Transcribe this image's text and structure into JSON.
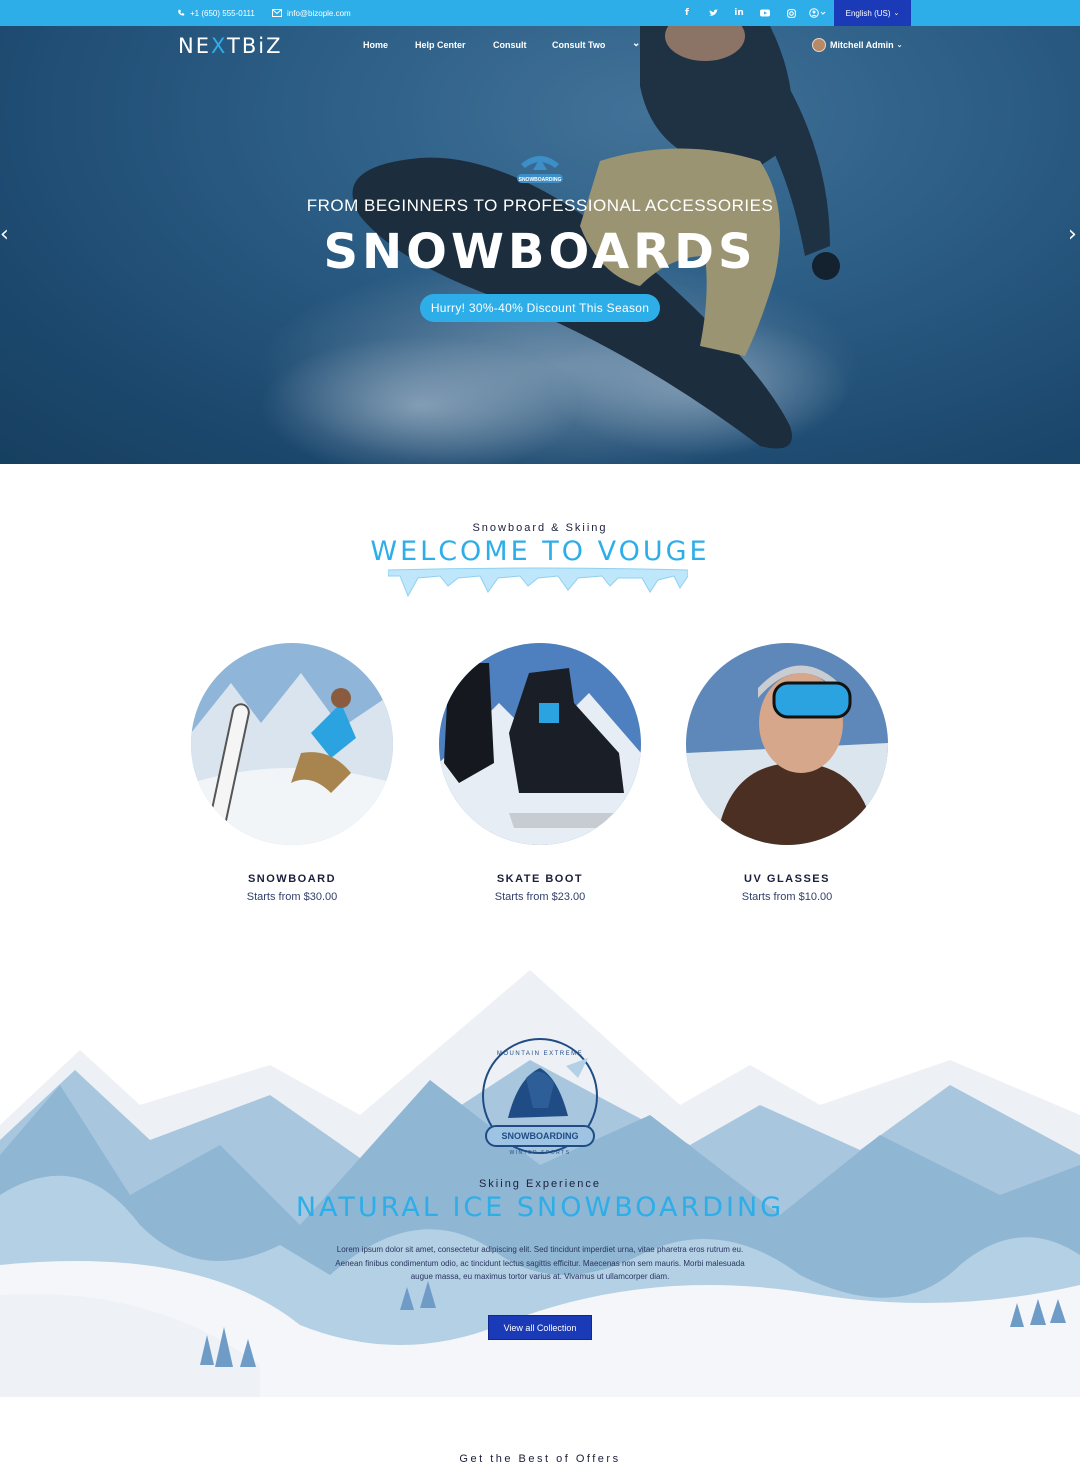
{
  "topbar": {
    "phone": "+1 (650) 555-0111",
    "email": "info@bizople.com",
    "social_icons": [
      "facebook-icon",
      "twitter-icon",
      "linkedin-icon",
      "youtube-icon",
      "instagram-icon",
      "account-icon"
    ],
    "language": "English (US)"
  },
  "header": {
    "logo": "NEXTBIZ",
    "nav": [
      "Home",
      "Help Center",
      "Consult",
      "Consult Two"
    ],
    "user_name": "Mitchell Admin"
  },
  "hero": {
    "badge": "SNOWBOARDING",
    "subtitle": "FROM BEGINNERS TO PROFESSIONAL ACCESSORIES",
    "title": "SNOWBOARDS",
    "button": "Hurry! 30%-40% Discount This Season"
  },
  "welcome": {
    "kicker": "Snowboard & Skiing",
    "title": "WELCOME TO VOUGE"
  },
  "products": [
    {
      "name": "SNOWBOARD",
      "price": "Starts from $30.00"
    },
    {
      "name": "SKATE BOOT",
      "price": "Starts from $23.00"
    },
    {
      "name": "UV GLASSES",
      "price": "Starts from $10.00"
    }
  ],
  "experience": {
    "badge_top": "MOUNTAIN EXTREME",
    "badge_main": "SNOWBOARDING",
    "badge_bottom": "WINTER SPORTS",
    "kicker": "Skiing Experience",
    "title": "NATURAL ICE SNOWBOARDING",
    "body": "Lorem ipsum dolor sit amet, consectetur adipiscing elit. Sed tincidunt imperdiet urna, vitae pharetra eros rutrum eu. Aenean finibus condimentum odio, ac tincidunt lectus sagittis efficitur. Maecenas non sem mauris. Morbi malesuada augue massa, eu maximus tortor varius at. Vivamus ut ullamcorper diam.",
    "button": "View all Collection"
  },
  "offers": {
    "kicker": "Get the Best of Offers"
  },
  "colors": {
    "accent": "#2eaee9",
    "brand_dark": "#1a3ab8",
    "text": "#1b1f3b"
  }
}
